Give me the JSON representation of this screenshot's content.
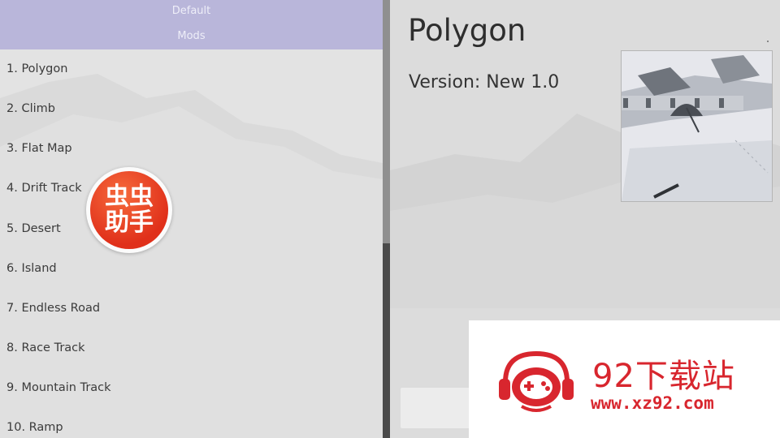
{
  "header": {
    "tab_default": "Default",
    "tab_mods": "Mods"
  },
  "mods": [
    "1. Polygon",
    "2. Climb",
    "3. Flat Map",
    "4. Drift Track",
    "5. Desert",
    "6. Island",
    "7. Endless Road",
    "8. Race Track",
    "9. Mountain Track",
    "10. Ramp"
  ],
  "detail": {
    "title": "Polygon",
    "version": "Version: New 1.0",
    "preview_icon": "map-preview-thumbnail"
  },
  "overlay_badge": {
    "line1": "虫虫",
    "line2": "助手"
  },
  "watermark": {
    "title": "92下载站",
    "url": "www.xz92.com",
    "logo_icon": "gamepad-headphones-icon"
  },
  "colors": {
    "header": "#b9b6da",
    "list_bg": "#e3e3e3",
    "panel_bg": "#dcdcdc",
    "badge_red": "#e0301a",
    "watermark_red": "#d8262e"
  }
}
